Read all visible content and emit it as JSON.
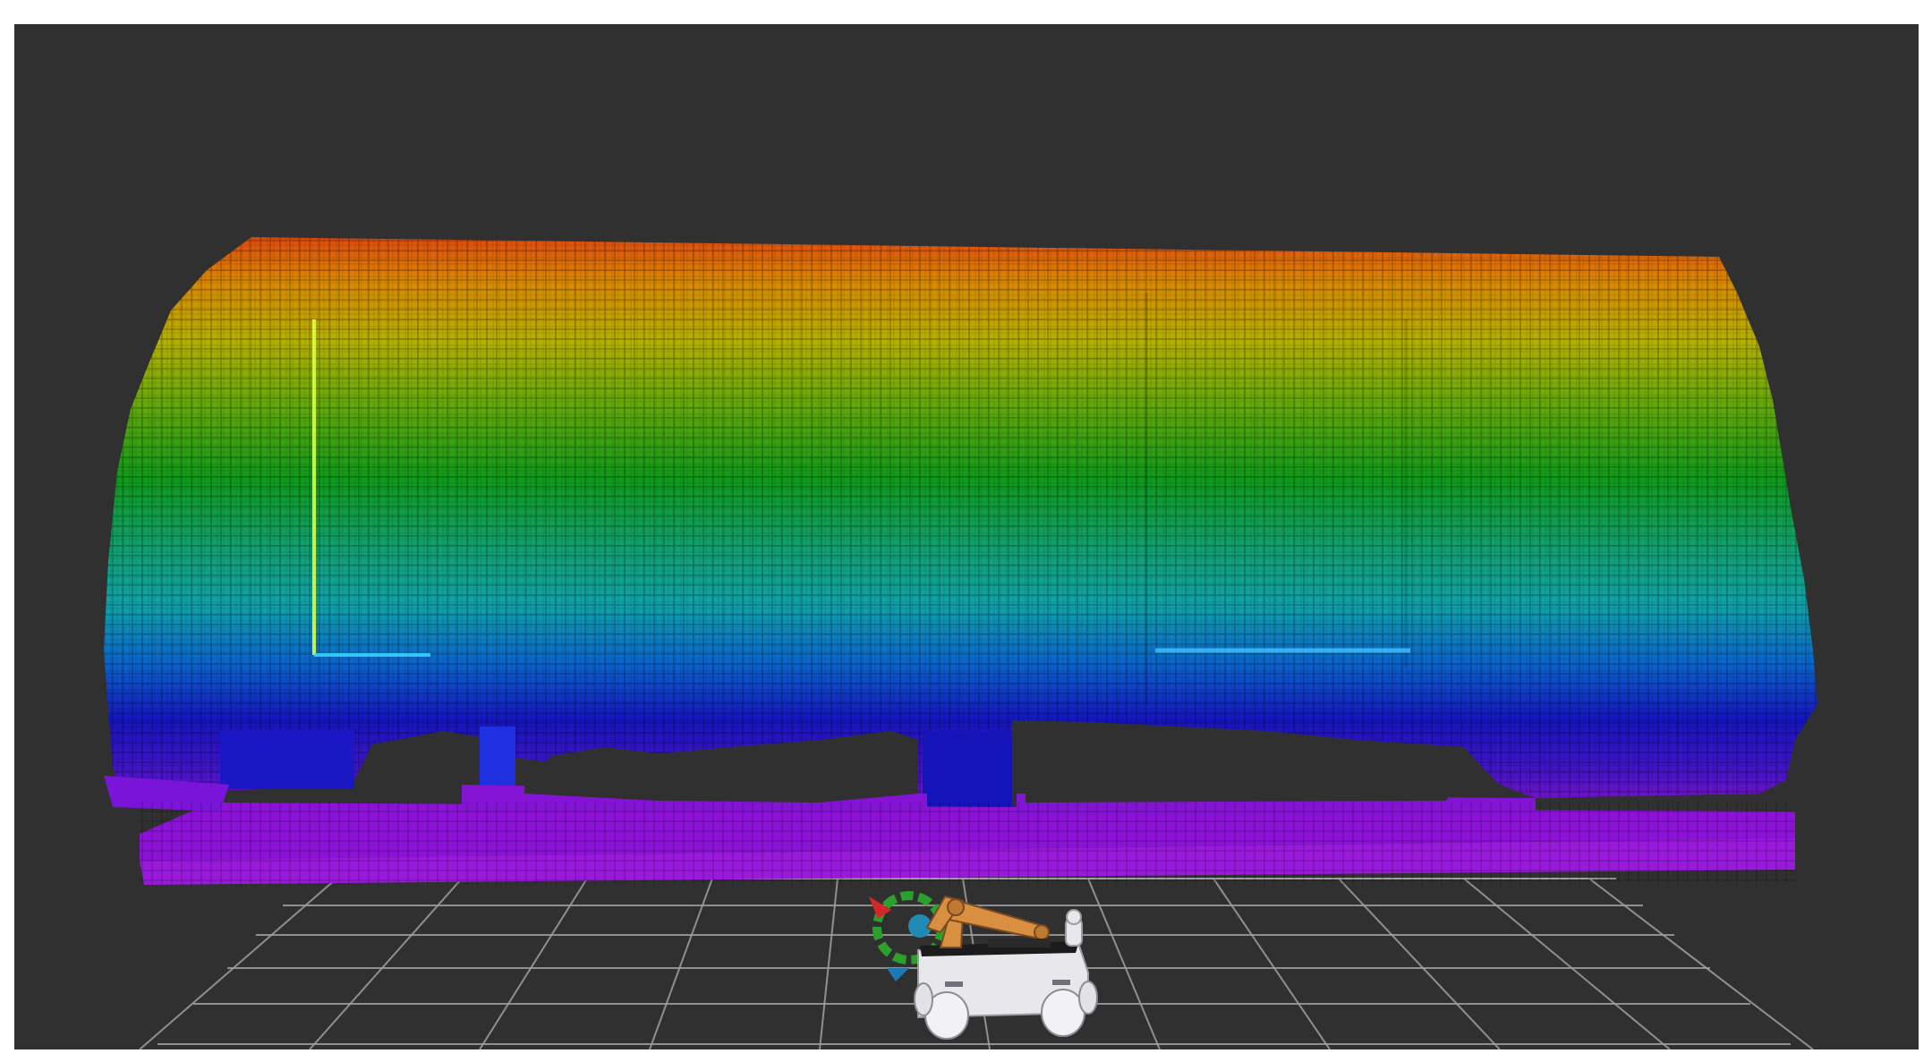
{
  "scene": {
    "background_color": "#303030",
    "page_background": "#ffffff",
    "grid_color": "#a0a0a0",
    "map": {
      "type": "octomap-voxels",
      "color_mode": "height-rainbow",
      "colors_bottom_to_top": [
        "#9a10d8",
        "#1010b8",
        "#0a5cd0",
        "#10a6a6",
        "#0fa020",
        "#7fb400",
        "#d4a000",
        "#e05010"
      ]
    },
    "robot": {
      "type": "mobile-manipulator",
      "body_color": "#e8e8ec",
      "arm_color": "#d89040",
      "marker_colors": [
        "#2ca02c",
        "#1f77b4",
        "#d62728"
      ]
    }
  }
}
